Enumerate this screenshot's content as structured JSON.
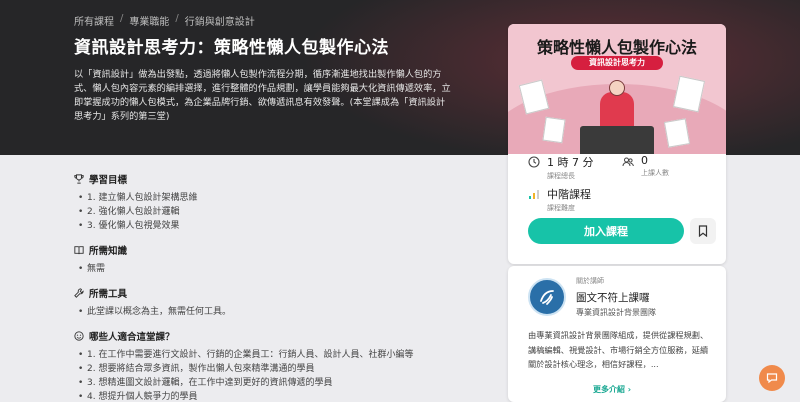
{
  "breadcrumb": [
    "所有課程",
    "專業職能",
    "行銷與創意設計"
  ],
  "breadcrumb_sep": "/",
  "course": {
    "title": "資訊設計思考力：策略性懶人包製作心法",
    "description": "以「資訊設計」做為出發點，透過將懶人包製作流程分期，循序漸進地找出製作懶人包的方式、懶人包內容元素的編排選擇，進行整體的作品規劃，讓學員能夠最大化資訊傳遞效率，立即掌握成功的懶人包模式，為企業品牌行銷、欲傳遞訊息有效發聲。(本堂課成為「資訊設計思考力」系列的第三堂)"
  },
  "sections": {
    "goals": {
      "title": "學習目標",
      "items": [
        "1. 建立懶人包設計架構思維",
        "2. 強化懶人包設計邏輯",
        "3. 優化懶人包視覺效果"
      ]
    },
    "knowledge": {
      "title": "所需知識",
      "items": [
        "無需"
      ]
    },
    "tools": {
      "title": "所需工具",
      "items": [
        "此堂課以概念為主，無需任何工具。"
      ]
    },
    "audience": {
      "title": "哪些人適合這堂課？",
      "items": [
        "1. 在工作中需要進行文設計、行銷的企業員工：行銷人員、設計人員、社群小編等",
        "2. 想要將結合眾多資訊，製作出懶人包來精準溝通的學員",
        "3. 想精進圖文設計邏輯，在工作中達到更好的資訊傳遞的學員",
        "4. 想提升個人競爭力的學員"
      ]
    }
  },
  "card": {
    "thumb_title": "策略性懶人包製作心法",
    "thumb_pill": "資訊設計思考力",
    "duration_value": "1 時 7 分",
    "duration_label": "課程總長",
    "students_value": "0",
    "students_label": "上課人數",
    "level_value": "中階課程",
    "level_label": "課程難度",
    "enroll_label": "加入課程"
  },
  "teacher": {
    "about_label": "關於講師",
    "name": "圖文不符上課囉",
    "subtitle": "專業資訊設計背景團隊",
    "description": "由專業資訊設計背景團隊組成，提供從課程規劃、講稿編輯、視覺設計、市場行銷全方位服務，延續關於設計核心理念，相信好課程，...",
    "more_label": "更多介紹"
  },
  "colors": {
    "accent": "#17c3a8",
    "chat": "#f08a4b",
    "hero": "#262628"
  }
}
